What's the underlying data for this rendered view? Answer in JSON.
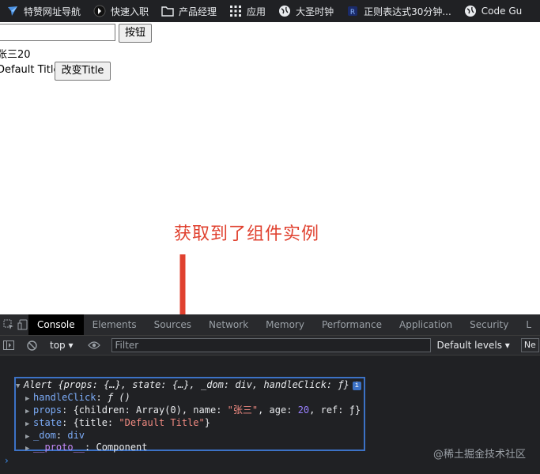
{
  "bookmarks": [
    {
      "label": "特赞网址导航",
      "icon": "tezign-icon"
    },
    {
      "label": "快速入职",
      "icon": "circle-logo-icon"
    },
    {
      "label": "产品经理",
      "icon": "folder-icon"
    },
    {
      "label": "应用",
      "icon": "apps-grid-icon"
    },
    {
      "label": "大圣时钟",
      "icon": "globe-icon"
    },
    {
      "label": "正则表达式30分钟...",
      "icon": "bookmark-logo-icon"
    },
    {
      "label": "Code Gu",
      "icon": "globe-icon"
    }
  ],
  "page": {
    "input_value": "",
    "submit_label": "按钮",
    "name_age_text": "张三20",
    "title_text": "Default Title",
    "change_title_label": "改变Title"
  },
  "annotation": {
    "text": "获取到了组件实例",
    "color": "#e0412f"
  },
  "devtools": {
    "tabs": [
      "Console",
      "Elements",
      "Sources",
      "Network",
      "Memory",
      "Performance",
      "Application",
      "Security",
      "L"
    ],
    "active_tab": "Console",
    "context": "top ▾",
    "filter_placeholder": "Filter",
    "levels": "Default levels ▾",
    "levels_overflow": "Ne",
    "object": {
      "summary_name": "Alert",
      "summary_rest": "{props: {…}, state: {…}, _dom: div, handleClick: ƒ}",
      "info_badge": "i",
      "lines": {
        "handleClick_key": "handleClick",
        "handleClick_val": "ƒ ()",
        "props_key": "props",
        "props_open": "{children: Array(0), name: ",
        "props_name": "\"张三\"",
        "props_mid": ", age: ",
        "props_age": "20",
        "props_end": ", ref: ƒ}",
        "state_key": "state",
        "state_open": "{title: ",
        "state_title": "\"Default Title\"",
        "state_close": "}",
        "dom_key": "_dom",
        "dom_val": "div",
        "proto_key": "__proto__",
        "proto_val": "Component"
      }
    },
    "prompt_symbol": "›"
  },
  "watermark": "@稀土掘金技术社区",
  "colors": {
    "accent_blue": "#3c72c6",
    "devtools_bg": "#202124",
    "key_color": "#7cacf8",
    "string_color": "#f28b82"
  }
}
